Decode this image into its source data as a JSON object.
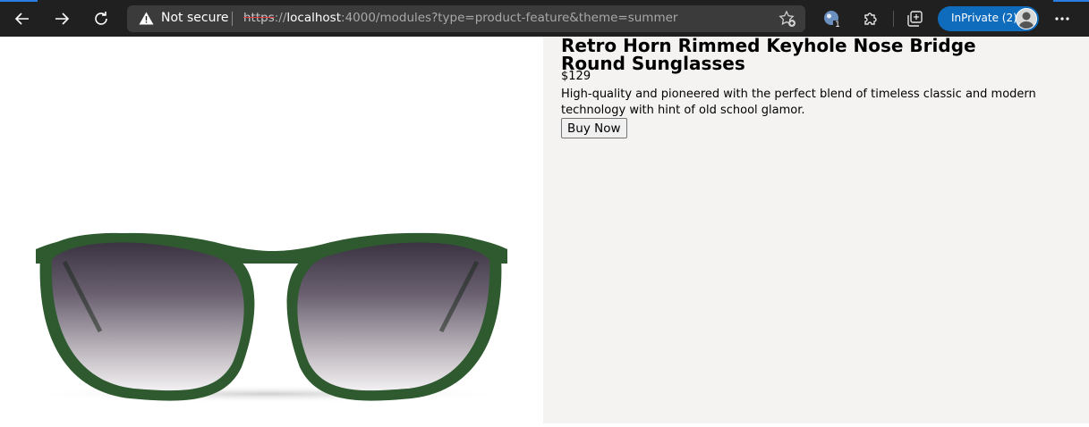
{
  "browser": {
    "not_secure_label": "Not secure",
    "url_scheme": "https",
    "url_separator": "://",
    "url_host": "localhost",
    "url_rest": ":4000/modules?type=product-feature&theme=summer",
    "extension_badge": "1",
    "profile_label": "InPrivate (2)",
    "accent_color": "#0f6cbd"
  },
  "product": {
    "title": "Retro Horn Rimmed Keyhole Nose Bridge Round Sunglasses",
    "price": "$129",
    "description": "High-quality and pioneered with the perfect blend of timeless classic and modern technology with hint of old school glamor.",
    "cta_label": "Buy Now",
    "frame_color": "#2f5a30",
    "panel_background": "#f4f3f2"
  }
}
